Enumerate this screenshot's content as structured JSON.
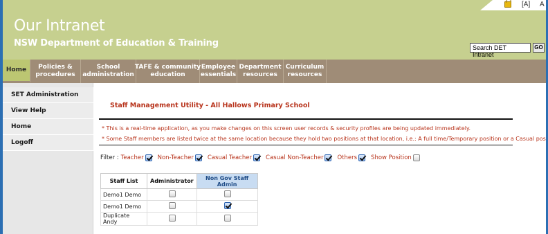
{
  "header": {
    "title": "Our Intranet",
    "subtitle": "NSW Department of Education & Training",
    "top_link_a": "[A]",
    "top_link_b": "A",
    "search_value": "Search DET Intranet",
    "go_label": "GO"
  },
  "nav": {
    "items": [
      {
        "label": "Home",
        "active": true
      },
      {
        "label": "Policies &\nprocedures"
      },
      {
        "label": "School\nadministration"
      },
      {
        "label": "TAFE & community\neducation"
      },
      {
        "label": "Employee\nessentials"
      },
      {
        "label": "Department\nresources"
      },
      {
        "label": "Curriculum\nresources"
      }
    ]
  },
  "sidebar": {
    "items": [
      {
        "label": "SET Administration"
      },
      {
        "label": "View Help"
      },
      {
        "label": "Home"
      },
      {
        "label": "Logoff"
      }
    ]
  },
  "main": {
    "title": "Staff Management Utility - All Hallows Primary School",
    "notice_1": "* This is a real-time application, as you make changes on this screen user records & security profiles are being updated immediately.",
    "notice_2": "* Some Staff members are listed twice at the same location because they hold two positions at that location, i.e.: A full time/Temporary position or a Casual position.",
    "filter": {
      "label": "Filter :",
      "options": [
        {
          "label": "Teacher",
          "checked": true
        },
        {
          "label": "Non-Teacher",
          "checked": true
        },
        {
          "label": "Casual Teacher",
          "checked": true
        },
        {
          "label": "Casual Non-Teacher",
          "checked": true
        },
        {
          "label": "Others",
          "checked": true
        },
        {
          "label": "Show Position",
          "checked": false
        }
      ]
    },
    "table": {
      "headers": [
        "Staff List",
        "Administrator",
        "Non Gov Staff Admin"
      ],
      "rows": [
        {
          "name": "Demo1 Demo",
          "administrator": false,
          "non_gov_admin": false
        },
        {
          "name": "Demo1 Demo",
          "administrator": false,
          "non_gov_admin": true
        },
        {
          "name": "Duplicate Andy",
          "administrator": false,
          "non_gov_admin": false
        }
      ]
    }
  },
  "colors": {
    "header_bg": "#c6d08f",
    "nav_bg": "#9f8c77",
    "nav_active": "#bcc672",
    "accent_red": "#b8341c",
    "frame_blue": "#2c6fb3",
    "sidebar_bg": "#e7e7e7"
  }
}
